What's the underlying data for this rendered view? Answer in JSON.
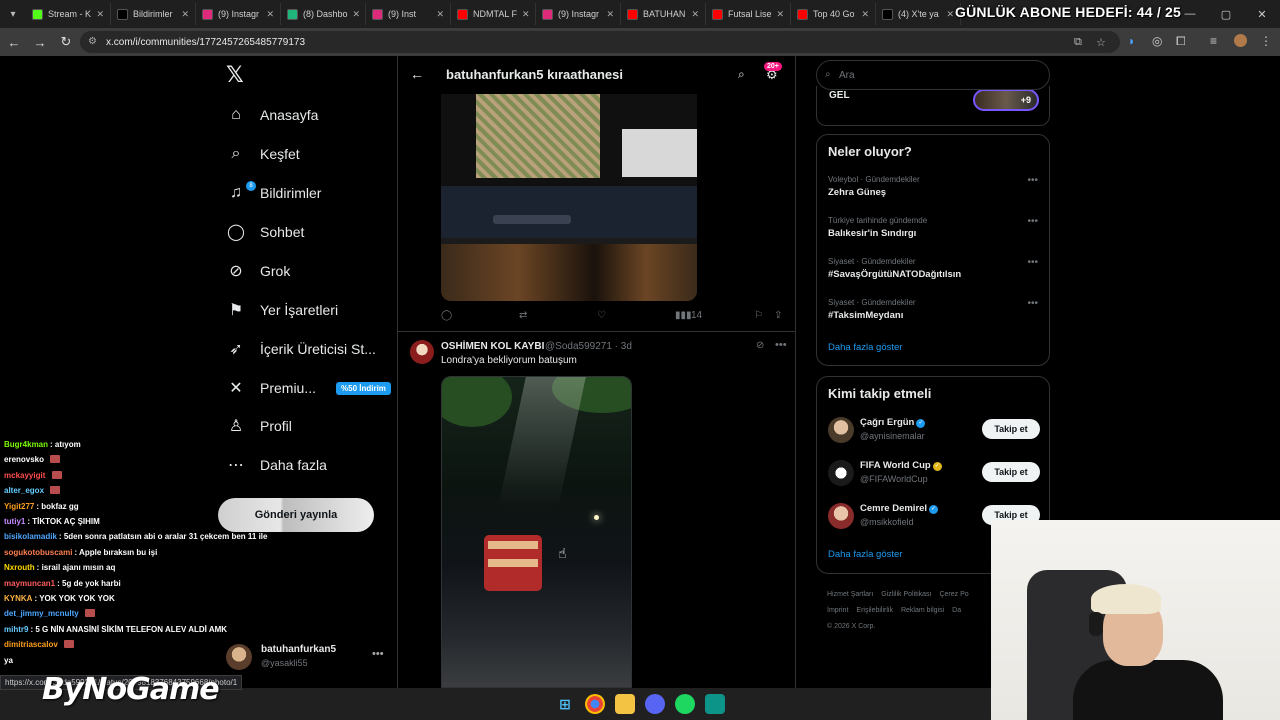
{
  "browser": {
    "tabs": [
      {
        "label": "Stream - K",
        "color": "#53fc18"
      },
      {
        "label": "Bildirimler",
        "color": "#000000"
      },
      {
        "label": "(9) Instagr",
        "color": "#dd2a7b"
      },
      {
        "label": "(8) Dashbo",
        "color": "#1fb57a"
      },
      {
        "label": "(9) Inst",
        "color": "#dd2a7b"
      },
      {
        "label": "NDMTAL F",
        "color": "#ff0000"
      },
      {
        "label": "(9) Instagr",
        "color": "#dd2a7b"
      },
      {
        "label": "BATUHAN",
        "color": "#ff0000"
      },
      {
        "label": "Futsal Lise",
        "color": "#ff0000"
      },
      {
        "label": "Top 40 Go",
        "color": "#ff0000"
      },
      {
        "label": "(4) X'te ya",
        "color": "#000000"
      }
    ],
    "url": "x.com/i/communities/1772457265485779173",
    "status_url": "https://x.com/Soda599271/status/2039818376843759668/photo/1"
  },
  "overlay": {
    "sub_goal": "GÜNLÜK ABONE HEDEFİ: 44 / 25",
    "brand": "ByNoGame"
  },
  "nav": {
    "items": [
      {
        "label": "Anasayfa",
        "icon": "home-icon"
      },
      {
        "label": "Keşfet",
        "icon": "search-icon"
      },
      {
        "label": "Bildirimler",
        "icon": "bell-icon"
      },
      {
        "label": "Sohbet",
        "icon": "chat-icon"
      },
      {
        "label": "Grok",
        "icon": "grok-icon"
      },
      {
        "label": "Yer İşaretleri",
        "icon": "bookmark-icon"
      },
      {
        "label": "İçerik Üreticisi St...",
        "icon": "rocket-icon"
      },
      {
        "label": "Premiu...",
        "icon": "x-icon"
      },
      {
        "label": "Profil",
        "icon": "person-icon"
      },
      {
        "label": "Daha fazla",
        "icon": "more-circle-icon"
      }
    ],
    "premium_promo": "%50 İndirim",
    "notif_badge": "8",
    "post_button": "Gönderi yayınla",
    "account": {
      "name": "batuhanfurkan5",
      "handle": "@yasakli55"
    }
  },
  "main": {
    "title": "batuhanfurkan5 kıraathanesi",
    "header_badge": "20+",
    "tweet1": {
      "views": "14"
    },
    "tweet2": {
      "name": "OSHİMEN KOL KAYBI",
      "handle": "@Soda599271",
      "time": "3d",
      "text": "Londra'ya bekliyorum batuşum"
    }
  },
  "right": {
    "search_placeholder": "Ara",
    "live_label": "GEL",
    "live_count": "+9",
    "trends_title": "Neler oluyor?",
    "trends": [
      {
        "context": "Voleybol · Gündemdekiler",
        "title": "Zehra Güneş"
      },
      {
        "context": "Türkiye tarihinde gündemde",
        "title": "Balıkesir'in Sındırgı"
      },
      {
        "context": "Siyaset · Gündemdekiler",
        "title": "#SavaşÖrgütüNATODağıtılsın"
      },
      {
        "context": "Siyaset · Gündemdekiler",
        "title": "#TaksimMeydanı"
      }
    ],
    "show_more": "Daha fazla göster",
    "who_title": "Kimi takip etmeli",
    "who": [
      {
        "name": "Çağrı Ergün",
        "handle": "@aynisinemalar",
        "badge_color": "#1d9bf0",
        "follow": "Takip et"
      },
      {
        "name": "FIFA World Cup",
        "handle": "@FIFAWorldCup",
        "badge_color": "#e2b719",
        "follow": "Takip et"
      },
      {
        "name": "Cemre Demirel",
        "handle": "@msikkofield",
        "badge_color": "#1d9bf0",
        "follow": "Takip et"
      }
    ],
    "footer": [
      "Hizmet Şartları",
      "Gizlilik Politikası",
      "Çerez Po",
      "İmprint",
      "Erişilebilirlik",
      "Reklam bilgisi",
      "Da",
      "© 2026 X Corp."
    ]
  },
  "chat": [
    {
      "user": "Bugr4kman",
      "color": "#7cfc00",
      "msg": "atıyom"
    },
    {
      "user": "erenovsko",
      "color": "#ffffff",
      "msg": ""
    },
    {
      "user": "mckayyigit",
      "color": "#ff4d4d",
      "msg": ""
    },
    {
      "user": "alter_egox",
      "color": "#66ccff",
      "msg": ""
    },
    {
      "user": "Yigit277",
      "color": "#ff9f1a",
      "msg": "bokfaz gg"
    },
    {
      "user": "tutiy1",
      "color": "#c58cff",
      "msg": "TİKTOK AÇ ŞIHIM"
    },
    {
      "user": "bisikolamadik",
      "color": "#4da6ff",
      "msg": "5den sonra patlatsın abi o aralar 31 çekcem ben 11 ile"
    },
    {
      "user": "sogukotobuscami",
      "color": "#ff7f50",
      "msg": "Apple bıraksın bu işi"
    },
    {
      "user": "Nxrouth",
      "color": "#ffd700",
      "msg": "israil ajanı mısın aq"
    },
    {
      "user": "maymuncan1",
      "color": "#ff5c5c",
      "msg": "5g de yok harbi"
    },
    {
      "user": "KYNKA",
      "color": "#ffb347",
      "msg": "YOK YOK YOK YOK"
    },
    {
      "user": "det_jimmy_mcnulty",
      "color": "#4da6ff",
      "msg": ""
    },
    {
      "user": "mihtr9",
      "color": "#66ccff",
      "msg": "5 G NİN ANASİNİ SİKİM TELEFON ALEV ALDİ AMK"
    },
    {
      "user": "dimitriascalov",
      "color": "#ff9f1a",
      "msg": ""
    },
    {
      "user": "",
      "color": "#ffffff",
      "msg": "ya"
    }
  ]
}
